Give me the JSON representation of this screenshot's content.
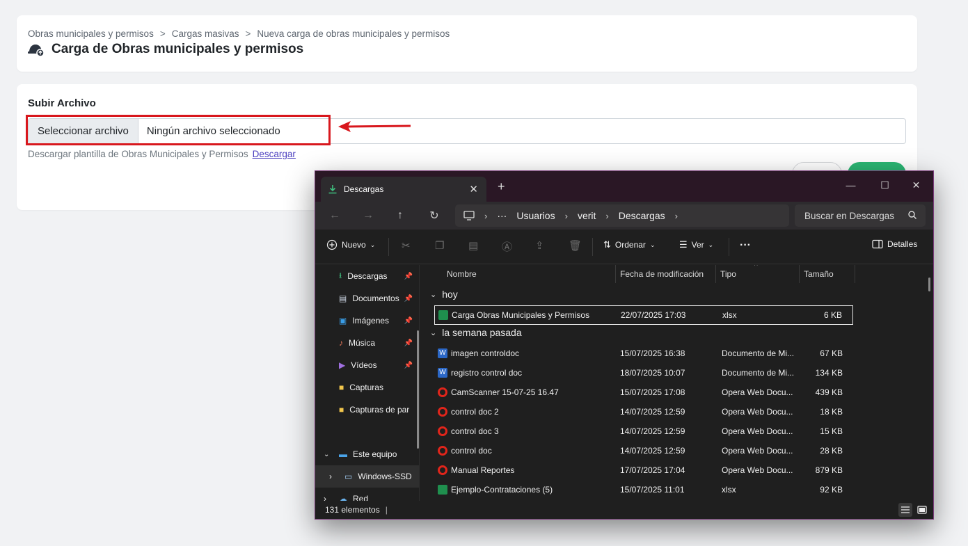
{
  "page": {
    "breadcrumb": [
      "Obras municipales y permisos",
      "Cargas masivas",
      "Nueva carga de obras municipales y permisos"
    ],
    "breadcrumb_separator": ">",
    "title": "Carga de Obras municipales y permisos"
  },
  "upload": {
    "section_title": "Subir Archivo",
    "select_button": "Seleccionar archivo",
    "file_status": "Ningún archivo seleccionado",
    "help_text": "Descargar plantilla de Obras Municipales y Permisos",
    "download_link": "Descargar"
  },
  "colors": {
    "annotation": "#d8171d",
    "accent_green": "#2bb673",
    "link": "#4b3fbf"
  },
  "explorer": {
    "tab_title": "Descargas",
    "address": [
      "Usuarios",
      "verit",
      "Descargas"
    ],
    "address_ellipsis": "···",
    "search_placeholder": "Buscar en Descargas",
    "toolbar": {
      "new": "Nuevo",
      "sort": "Ordenar",
      "view": "Ver",
      "more": "···",
      "details": "Detalles"
    },
    "sidebar": [
      {
        "label": "Descargas",
        "icon": "download-icon",
        "pinned": true
      },
      {
        "label": "Documentos",
        "icon": "document-icon",
        "pinned": true
      },
      {
        "label": "Imágenes",
        "icon": "image-icon",
        "pinned": true
      },
      {
        "label": "Música",
        "icon": "music-icon",
        "pinned": true
      },
      {
        "label": "Vídeos",
        "icon": "video-icon",
        "pinned": true
      },
      {
        "label": "Capturas",
        "icon": "folder-icon",
        "pinned": false
      },
      {
        "label": "Capturas de par",
        "icon": "folder-icon",
        "pinned": false
      },
      {
        "label": "Este equipo",
        "icon": "computer-icon",
        "pinned": false
      },
      {
        "label": "Windows-SSD",
        "icon": "drive-icon",
        "pinned": false
      },
      {
        "label": "Red",
        "icon": "network-icon",
        "pinned": false
      }
    ],
    "columns": [
      "Nombre",
      "Fecha de modificación",
      "Tipo",
      "Tamaño"
    ],
    "groups": [
      {
        "label": "hoy",
        "files": [
          {
            "name": "Carga Obras Municipales y Permisos",
            "date": "22/07/2025 17:03",
            "type": "xlsx",
            "size": "6 KB",
            "icon": "excel-icon"
          }
        ]
      },
      {
        "label": "la semana pasada",
        "files": [
          {
            "name": "imagen controldoc",
            "date": "15/07/2025 16:38",
            "type": "Documento de Mi...",
            "size": "67 KB",
            "icon": "word-icon"
          },
          {
            "name": "registro control doc",
            "date": "18/07/2025 10:07",
            "type": "Documento de Mi...",
            "size": "134 KB",
            "icon": "word-icon"
          },
          {
            "name": "CamScanner 15-07-25 16.47",
            "date": "15/07/2025 17:08",
            "type": "Opera Web Docu...",
            "size": "439 KB",
            "icon": "opera-icon"
          },
          {
            "name": "control doc 2",
            "date": "14/07/2025 12:59",
            "type": "Opera Web Docu...",
            "size": "18 KB",
            "icon": "opera-icon"
          },
          {
            "name": "control doc 3",
            "date": "14/07/2025 12:59",
            "type": "Opera Web Docu...",
            "size": "15 KB",
            "icon": "opera-icon"
          },
          {
            "name": "control doc",
            "date": "14/07/2025 12:59",
            "type": "Opera Web Docu...",
            "size": "28 KB",
            "icon": "opera-icon"
          },
          {
            "name": "Manual Reportes",
            "date": "17/07/2025 17:04",
            "type": "Opera Web Docu...",
            "size": "879 KB",
            "icon": "opera-icon"
          },
          {
            "name": "Ejemplo-Contrataciones (5)",
            "date": "15/07/2025 11:01",
            "type": "xlsx",
            "size": "92 KB",
            "icon": "excel-icon"
          }
        ]
      }
    ],
    "status": "131 elementos"
  }
}
